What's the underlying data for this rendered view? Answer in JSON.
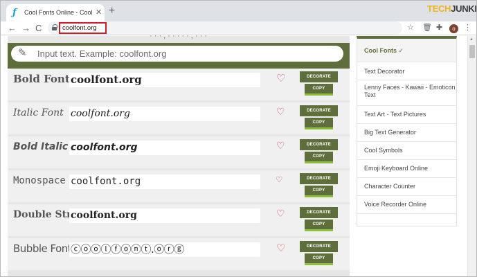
{
  "browser": {
    "tab_title": "Cool Fonts Online - Cool Fancy S",
    "tab_favicon": "ƒ",
    "tab_close": "✕",
    "new_tab": "+",
    "url": "coolfont.org",
    "back": "←",
    "forward": "→",
    "reload": "C",
    "star": "☆",
    "ext1": "🗑",
    "ext2": "✚",
    "avatar": "o",
    "menu": "⋮",
    "watermark_a": "TECH",
    "watermark_b": "JUNKIE"
  },
  "search": {
    "placeholder": "Input text. Example: coolfont.org"
  },
  "cut_text": "· · ·    ,  · · · · · , · · ·",
  "fonts": [
    {
      "label": "Bold Font",
      "preview": "coolfont.org",
      "decorate": "DECORATE",
      "copy": "COPY"
    },
    {
      "label": "Italic Font",
      "preview": "coolfont.org",
      "decorate": "DECORATE",
      "copy": "COPY"
    },
    {
      "label": "Bold Italic Font",
      "preview": "coolfont.org",
      "decorate": "DECORATE",
      "copy": "COPY"
    },
    {
      "label": "Monospace Font",
      "preview": "coolfont.org",
      "decorate": "DECORATE",
      "copy": "COPY"
    },
    {
      "label": "Double Struck Font",
      "preview": "coolfont.org",
      "decorate": "DECORATE",
      "copy": "COPY"
    },
    {
      "label": "Bubble Font",
      "preview": "ⓒⓞⓞⓛⓕⓞⓝⓣ.ⓞⓡⓖ",
      "decorate": "DECORATE",
      "copy": "COPY"
    }
  ],
  "sidebar": {
    "items": [
      {
        "label": "Cool Fonts ✓"
      },
      {
        "label": "Text Decorator"
      },
      {
        "label": "Lenny Faces - Kawaii - Emoticon Text"
      },
      {
        "label": "Text Art - Text Pictures"
      },
      {
        "label": "Big Text Generator"
      },
      {
        "label": "Cool Symbols"
      },
      {
        "label": "Emoji Keyboard Online"
      },
      {
        "label": "Character Counter"
      },
      {
        "label": "Voice Recorder Online"
      }
    ]
  },
  "icons": {
    "heart": "♡",
    "pencil": "✎",
    "scroll_up": "▲"
  },
  "colors": {
    "accent": "#5f6f3b",
    "copy_underline": "#8bbf3c",
    "heart": "#d9435a",
    "url_highlight": "#d7192a"
  }
}
